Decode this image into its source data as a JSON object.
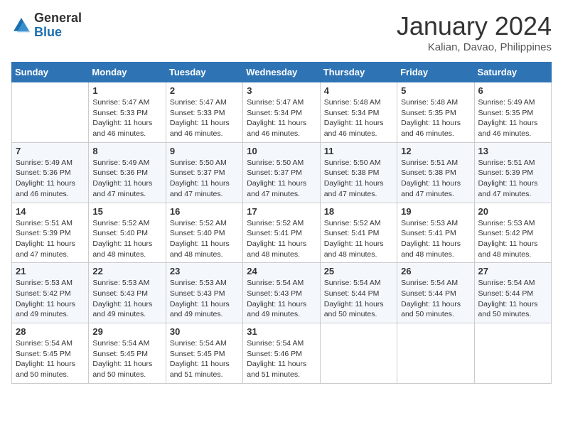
{
  "logo": {
    "text_general": "General",
    "text_blue": "Blue"
  },
  "header": {
    "title": "January 2024",
    "subtitle": "Kalian, Davao, Philippines"
  },
  "weekdays": [
    "Sunday",
    "Monday",
    "Tuesday",
    "Wednesday",
    "Thursday",
    "Friday",
    "Saturday"
  ],
  "weeks": [
    [
      {
        "day": "",
        "info": ""
      },
      {
        "day": "1",
        "info": "Sunrise: 5:47 AM\nSunset: 5:33 PM\nDaylight: 11 hours\nand 46 minutes."
      },
      {
        "day": "2",
        "info": "Sunrise: 5:47 AM\nSunset: 5:33 PM\nDaylight: 11 hours\nand 46 minutes."
      },
      {
        "day": "3",
        "info": "Sunrise: 5:47 AM\nSunset: 5:34 PM\nDaylight: 11 hours\nand 46 minutes."
      },
      {
        "day": "4",
        "info": "Sunrise: 5:48 AM\nSunset: 5:34 PM\nDaylight: 11 hours\nand 46 minutes."
      },
      {
        "day": "5",
        "info": "Sunrise: 5:48 AM\nSunset: 5:35 PM\nDaylight: 11 hours\nand 46 minutes."
      },
      {
        "day": "6",
        "info": "Sunrise: 5:49 AM\nSunset: 5:35 PM\nDaylight: 11 hours\nand 46 minutes."
      }
    ],
    [
      {
        "day": "7",
        "info": "Sunrise: 5:49 AM\nSunset: 5:36 PM\nDaylight: 11 hours\nand 46 minutes."
      },
      {
        "day": "8",
        "info": "Sunrise: 5:49 AM\nSunset: 5:36 PM\nDaylight: 11 hours\nand 47 minutes."
      },
      {
        "day": "9",
        "info": "Sunrise: 5:50 AM\nSunset: 5:37 PM\nDaylight: 11 hours\nand 47 minutes."
      },
      {
        "day": "10",
        "info": "Sunrise: 5:50 AM\nSunset: 5:37 PM\nDaylight: 11 hours\nand 47 minutes."
      },
      {
        "day": "11",
        "info": "Sunrise: 5:50 AM\nSunset: 5:38 PM\nDaylight: 11 hours\nand 47 minutes."
      },
      {
        "day": "12",
        "info": "Sunrise: 5:51 AM\nSunset: 5:38 PM\nDaylight: 11 hours\nand 47 minutes."
      },
      {
        "day": "13",
        "info": "Sunrise: 5:51 AM\nSunset: 5:39 PM\nDaylight: 11 hours\nand 47 minutes."
      }
    ],
    [
      {
        "day": "14",
        "info": "Sunrise: 5:51 AM\nSunset: 5:39 PM\nDaylight: 11 hours\nand 47 minutes."
      },
      {
        "day": "15",
        "info": "Sunrise: 5:52 AM\nSunset: 5:40 PM\nDaylight: 11 hours\nand 48 minutes."
      },
      {
        "day": "16",
        "info": "Sunrise: 5:52 AM\nSunset: 5:40 PM\nDaylight: 11 hours\nand 48 minutes."
      },
      {
        "day": "17",
        "info": "Sunrise: 5:52 AM\nSunset: 5:41 PM\nDaylight: 11 hours\nand 48 minutes."
      },
      {
        "day": "18",
        "info": "Sunrise: 5:52 AM\nSunset: 5:41 PM\nDaylight: 11 hours\nand 48 minutes."
      },
      {
        "day": "19",
        "info": "Sunrise: 5:53 AM\nSunset: 5:41 PM\nDaylight: 11 hours\nand 48 minutes."
      },
      {
        "day": "20",
        "info": "Sunrise: 5:53 AM\nSunset: 5:42 PM\nDaylight: 11 hours\nand 48 minutes."
      }
    ],
    [
      {
        "day": "21",
        "info": "Sunrise: 5:53 AM\nSunset: 5:42 PM\nDaylight: 11 hours\nand 49 minutes."
      },
      {
        "day": "22",
        "info": "Sunrise: 5:53 AM\nSunset: 5:43 PM\nDaylight: 11 hours\nand 49 minutes."
      },
      {
        "day": "23",
        "info": "Sunrise: 5:53 AM\nSunset: 5:43 PM\nDaylight: 11 hours\nand 49 minutes."
      },
      {
        "day": "24",
        "info": "Sunrise: 5:54 AM\nSunset: 5:43 PM\nDaylight: 11 hours\nand 49 minutes."
      },
      {
        "day": "25",
        "info": "Sunrise: 5:54 AM\nSunset: 5:44 PM\nDaylight: 11 hours\nand 50 minutes."
      },
      {
        "day": "26",
        "info": "Sunrise: 5:54 AM\nSunset: 5:44 PM\nDaylight: 11 hours\nand 50 minutes."
      },
      {
        "day": "27",
        "info": "Sunrise: 5:54 AM\nSunset: 5:44 PM\nDaylight: 11 hours\nand 50 minutes."
      }
    ],
    [
      {
        "day": "28",
        "info": "Sunrise: 5:54 AM\nSunset: 5:45 PM\nDaylight: 11 hours\nand 50 minutes."
      },
      {
        "day": "29",
        "info": "Sunrise: 5:54 AM\nSunset: 5:45 PM\nDaylight: 11 hours\nand 50 minutes."
      },
      {
        "day": "30",
        "info": "Sunrise: 5:54 AM\nSunset: 5:45 PM\nDaylight: 11 hours\nand 51 minutes."
      },
      {
        "day": "31",
        "info": "Sunrise: 5:54 AM\nSunset: 5:46 PM\nDaylight: 11 hours\nand 51 minutes."
      },
      {
        "day": "",
        "info": ""
      },
      {
        "day": "",
        "info": ""
      },
      {
        "day": "",
        "info": ""
      }
    ]
  ]
}
